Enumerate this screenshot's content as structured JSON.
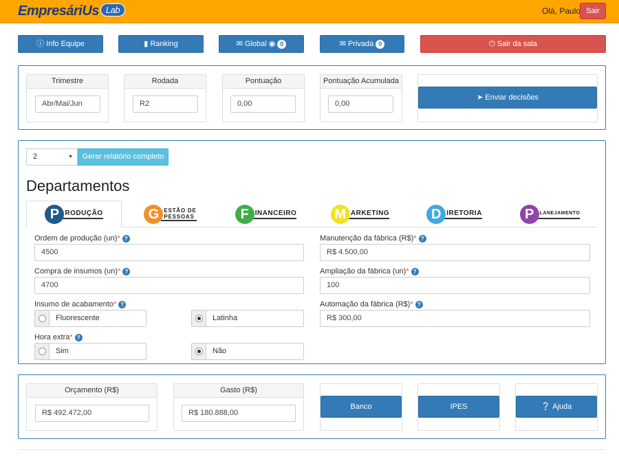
{
  "header": {
    "logo_text": "EmpresáriUs",
    "logo_badge": "Lab",
    "greeting": "Olá, Paulo.",
    "logout_label": "Sair"
  },
  "toolbar": {
    "info_label": "Info Equipe",
    "ranking_label": "Ranking",
    "global_label": "Global",
    "global_count": "0",
    "private_label": "Privada",
    "private_count": "0",
    "leave_label": "Sair da sala"
  },
  "status": {
    "quarter_label": "Trimestre",
    "quarter_value": "Abr/Mai/Jun",
    "round_label": "Rodada",
    "round_value": "R2",
    "score_label": "Pontuação",
    "score_value": "0,00",
    "acc_score_label": "Pontuação Acumulada",
    "acc_score_value": "0,00",
    "submit_label": "Enviar decisões"
  },
  "report": {
    "selected": "2",
    "button_label": "Gerar relatório completo"
  },
  "departments": {
    "title": "Departamentos",
    "tabs": [
      {
        "letter": "P",
        "rest": "RODUÇÃO",
        "color": "#1f5a8a",
        "active": true
      },
      {
        "letter": "G",
        "rest_line1": "ESTÃO DE",
        "rest_line2": "PESSOAS",
        "color": "#f0902a",
        "active": false
      },
      {
        "letter": "F",
        "rest": "INANCEIRO",
        "color": "#3fae49",
        "active": false
      },
      {
        "letter": "M",
        "rest": "ARKETING",
        "color": "#f2e21e",
        "active": false
      },
      {
        "letter": "D",
        "rest": "IRETORIA",
        "color": "#3fa9e0",
        "active": false
      },
      {
        "letter": "P",
        "rest": "LANEJAMENTO",
        "color": "#8e44ad",
        "active": false
      }
    ]
  },
  "form": {
    "ordem_label": "Ordem de produção (un)",
    "ordem_value": "4500",
    "insumos_label": "Compra de insumos (un)",
    "insumos_value": "4700",
    "acabamento_label": "Insumo de acabamento",
    "acabamento_opt1": "Fluorescente",
    "acabamento_opt2": "Latinha",
    "hora_label": "Hora extra",
    "hora_opt1": "Sim",
    "hora_opt2": "Não",
    "manutencao_label": "Manutenção da fábrica (R$)",
    "manutencao_value": "R$ 4.500,00",
    "ampliacao_label": "Ampliação da fábrica (un)",
    "ampliacao_value": "100",
    "automacao_label": "Automação da fábrica (R$)",
    "automacao_value": "R$ 300,00",
    "required_mark": "*",
    "help_glyph": "?"
  },
  "budget": {
    "orcamento_label": "Orçamento (R$)",
    "orcamento_value": "R$ 492.472,00",
    "gasto_label": "Gasto (R$)",
    "gasto_value": "R$ 180.888,00",
    "banco_label": "Banco",
    "ipes_label": "IPES",
    "ajuda_label": "Ajuda"
  }
}
